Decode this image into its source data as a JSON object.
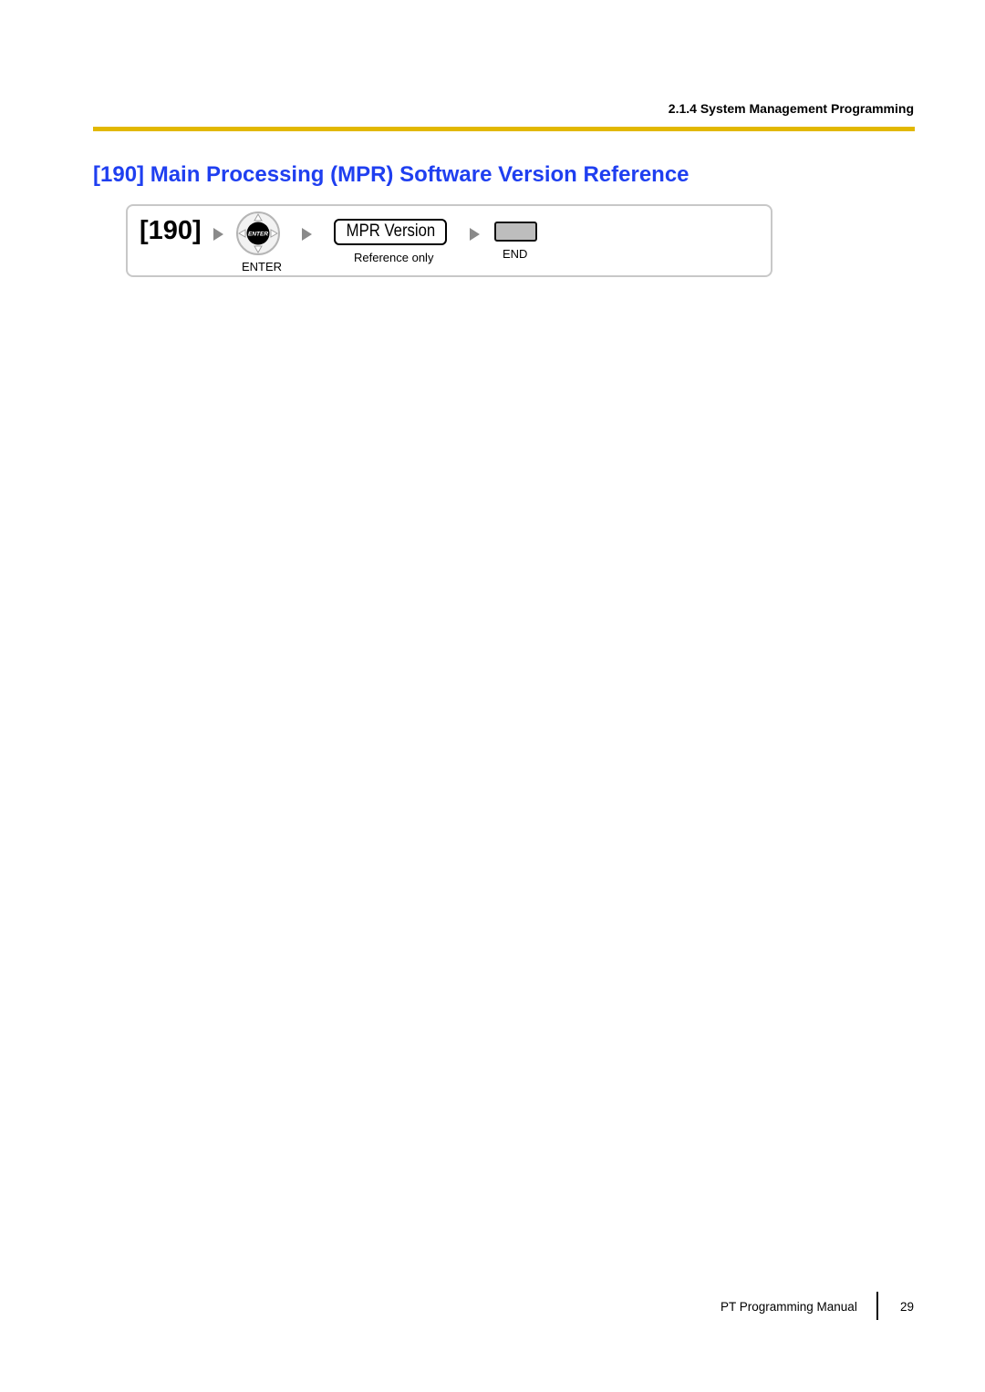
{
  "header": {
    "section": "2.1.4 System Management Programming",
    "rule_color": "#e2b800"
  },
  "title": {
    "text": "[190] Main Processing (MPR) Software Version Reference",
    "color": "#1f3ff0"
  },
  "flow": {
    "program_number": "[190]",
    "steps": [
      {
        "icon": "enter-navigator-key-icon",
        "key_text": "ENTER",
        "label": "ENTER"
      },
      {
        "display": "MPR Version",
        "label": "Reference only"
      },
      {
        "icon": "end-key-icon",
        "label": "END"
      }
    ]
  },
  "footer": {
    "manual_title": "PT Programming Manual",
    "page_number": "29"
  }
}
